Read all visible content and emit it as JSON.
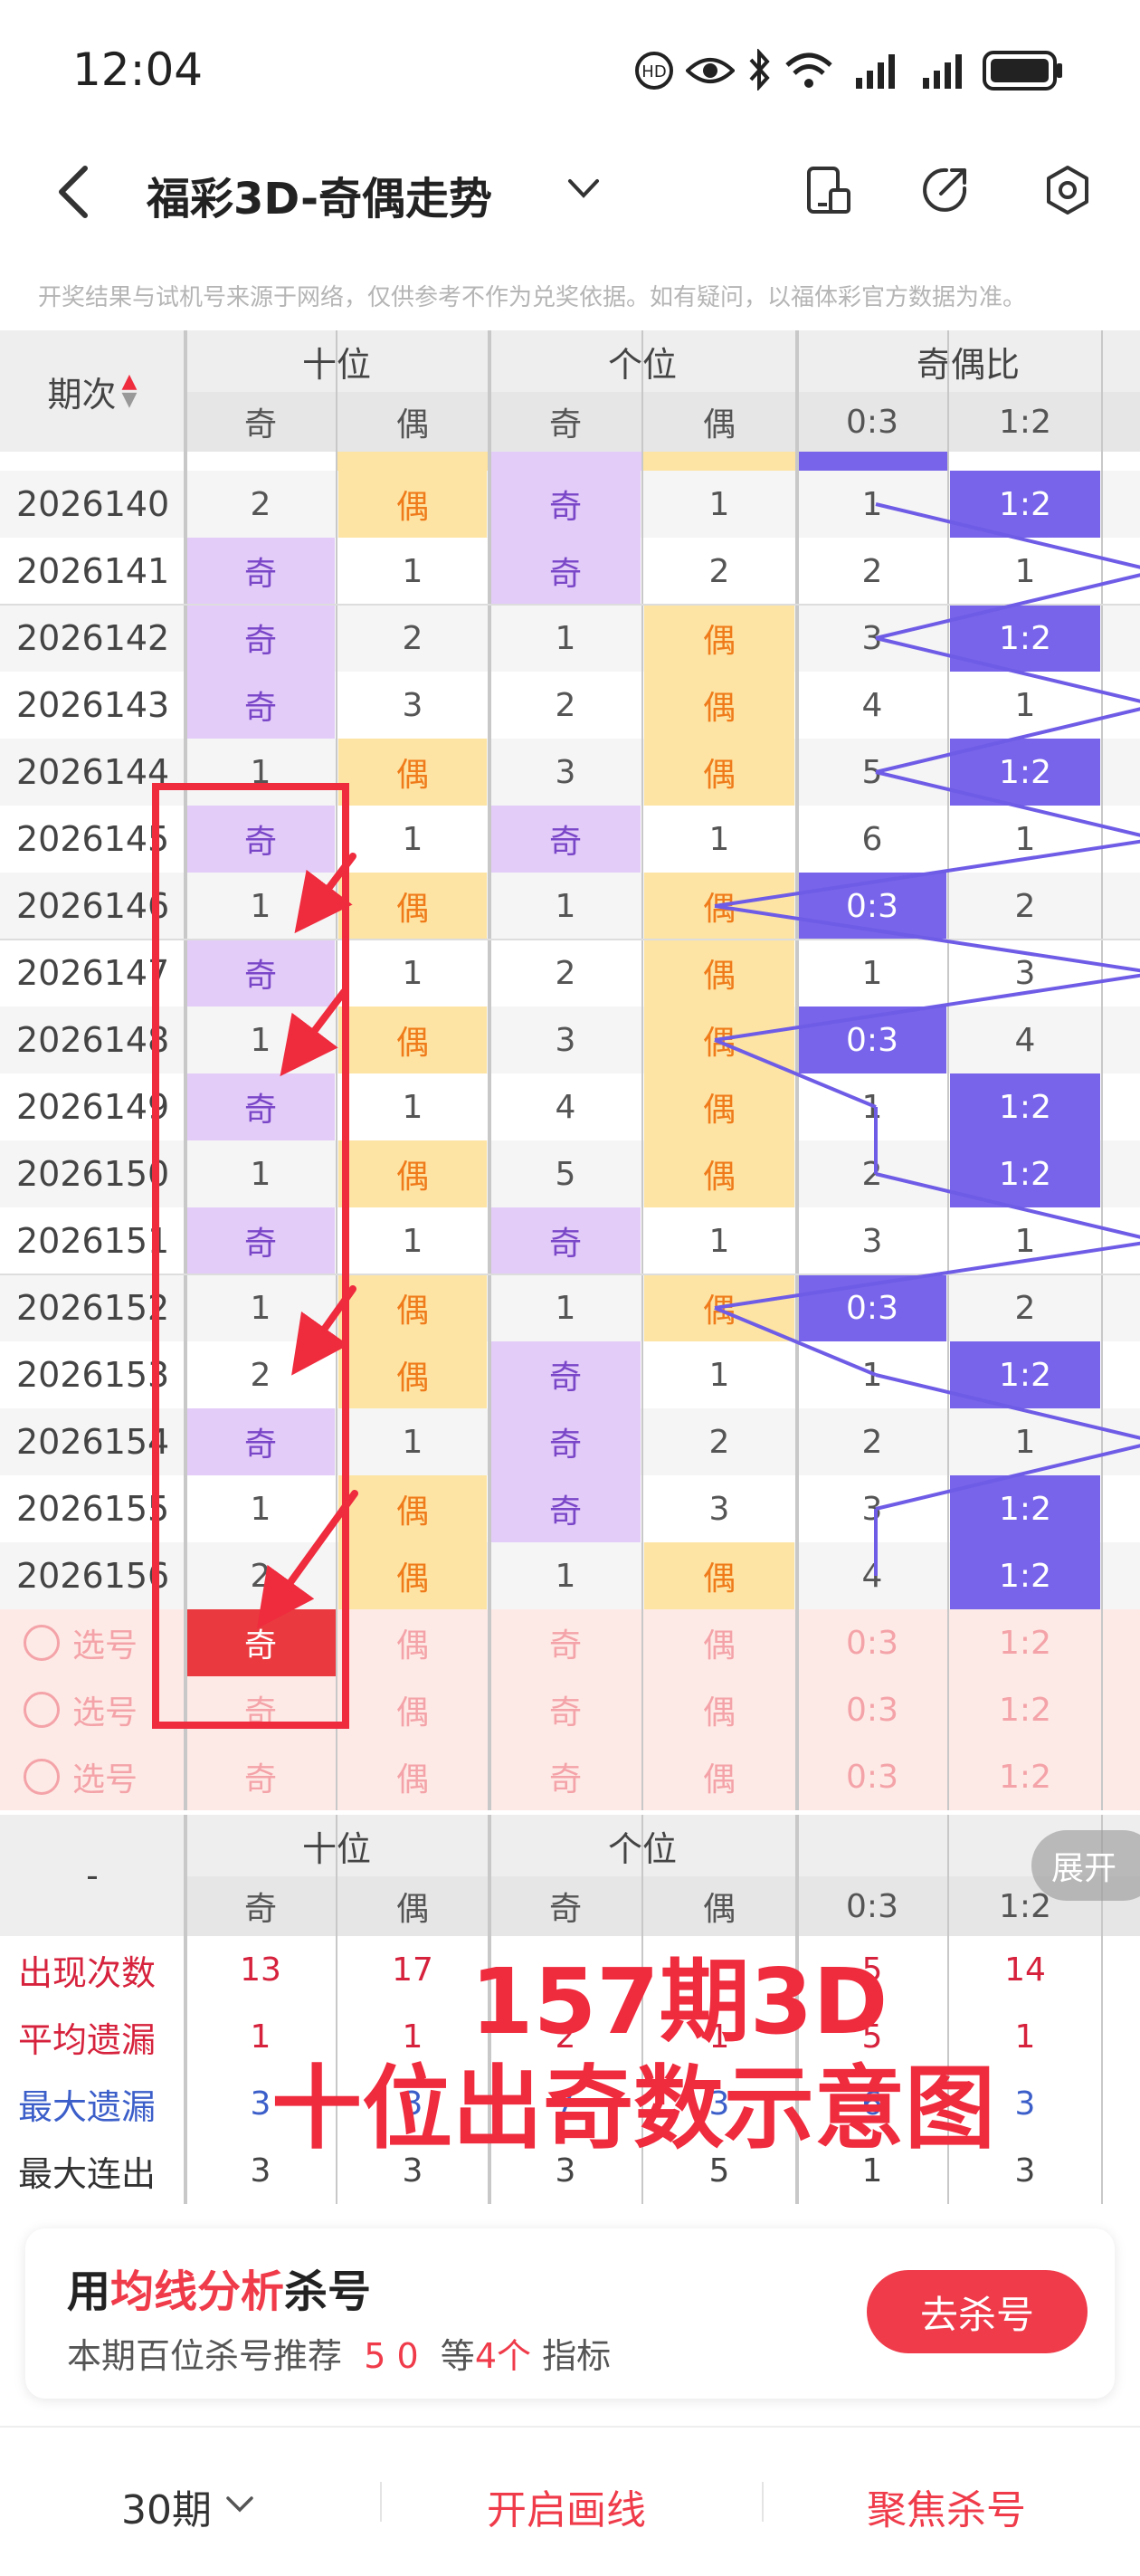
{
  "status_bar": {
    "time": "12:04",
    "icons": [
      "hd-call-icon",
      "eye-icon",
      "bluetooth-icon",
      "wifi-icon",
      "signal-icon",
      "signal-icon",
      "battery-icon"
    ]
  },
  "nav": {
    "title": "福彩3D-奇偶走势",
    "caret": "∨"
  },
  "disclaimer": "开奖结果与试机号来源于网络，仅供参考不作为兑奖依据。如有疑问，以福体彩官方数据为准。",
  "table": {
    "issue_header": "期次",
    "group_headers": [
      "十位",
      "个位",
      "奇偶比"
    ],
    "sub_headers": [
      "奇",
      "偶",
      "奇",
      "偶",
      "0:3",
      "1:2"
    ],
    "rows": [
      {
        "issue": "2026140",
        "cells": [
          "2",
          "偶",
          "奇",
          "1",
          "1",
          "1:2"
        ]
      },
      {
        "issue": "2026141",
        "cells": [
          "奇",
          "1",
          "奇",
          "2",
          "2",
          "1"
        ]
      },
      {
        "issue": "2026142",
        "cells": [
          "奇",
          "2",
          "1",
          "偶",
          "3",
          "1:2"
        ]
      },
      {
        "issue": "2026143",
        "cells": [
          "奇",
          "3",
          "2",
          "偶",
          "4",
          "1"
        ]
      },
      {
        "issue": "2026144",
        "cells": [
          "1",
          "偶",
          "3",
          "偶",
          "5",
          "1:2"
        ]
      },
      {
        "issue": "2026145",
        "cells": [
          "奇",
          "1",
          "奇",
          "1",
          "6",
          "1"
        ]
      },
      {
        "issue": "2026146",
        "cells": [
          "1",
          "偶",
          "1",
          "偶",
          "0:3",
          "2"
        ]
      },
      {
        "issue": "2026147",
        "cells": [
          "奇",
          "1",
          "2",
          "偶",
          "1",
          "3"
        ]
      },
      {
        "issue": "2026148",
        "cells": [
          "1",
          "偶",
          "3",
          "偶",
          "0:3",
          "4"
        ]
      },
      {
        "issue": "2026149",
        "cells": [
          "奇",
          "1",
          "4",
          "偶",
          "1",
          "1:2"
        ]
      },
      {
        "issue": "2026150",
        "cells": [
          "1",
          "偶",
          "5",
          "偶",
          "2",
          "1:2"
        ]
      },
      {
        "issue": "2026151",
        "cells": [
          "奇",
          "1",
          "奇",
          "1",
          "3",
          "1"
        ]
      },
      {
        "issue": "2026152",
        "cells": [
          "1",
          "偶",
          "1",
          "偶",
          "0:3",
          "2"
        ]
      },
      {
        "issue": "2026153",
        "cells": [
          "2",
          "偶",
          "奇",
          "1",
          "1",
          "1:2"
        ]
      },
      {
        "issue": "2026154",
        "cells": [
          "奇",
          "1",
          "奇",
          "2",
          "2",
          "1"
        ]
      },
      {
        "issue": "2026155",
        "cells": [
          "1",
          "偶",
          "奇",
          "3",
          "3",
          "1:2"
        ]
      },
      {
        "issue": "2026156",
        "cells": [
          "2",
          "偶",
          "1",
          "偶",
          "4",
          "1:2"
        ]
      }
    ],
    "select_label": "选号",
    "select_cells": [
      "奇",
      "偶",
      "奇",
      "偶",
      "0:3",
      "1:2"
    ]
  },
  "stats": {
    "dash": "-",
    "group_headers": [
      "十位",
      "个位"
    ],
    "sub_headers": [
      "奇",
      "偶",
      "奇",
      "偶",
      "0:3",
      "1:2"
    ],
    "rows": [
      {
        "label": "出现次数",
        "values": [
          "13",
          "17",
          "",
          "",
          "5",
          "14"
        ]
      },
      {
        "label": "平均遗漏",
        "values": [
          "1",
          "1",
          "2",
          "1",
          "5",
          "1"
        ]
      },
      {
        "label": "最大遗漏",
        "values": [
          "3",
          "3",
          "7",
          "3",
          "6",
          "3"
        ]
      },
      {
        "label": "最大连出",
        "values": [
          "3",
          "3",
          "3",
          "5",
          "1",
          "3"
        ]
      }
    ],
    "expand_label": "展开"
  },
  "annotation": {
    "line1": "157期3D",
    "line2": "十位出奇数示意图"
  },
  "promo": {
    "title_pre": "用",
    "title_highlight": "均线分析",
    "title_post": "杀号",
    "sub_pre": "本期百位杀号推荐",
    "sub_nums": "5 0",
    "sub_mid": "等",
    "sub_count": "4个",
    "sub_post": "指标",
    "button": "去杀号"
  },
  "bottom_bar": {
    "period": "30期",
    "period_caret": "∨",
    "draw_line": "开启画线",
    "focus_kill": "聚焦杀号"
  },
  "colors": {
    "odd_bg": "#e3ccf8",
    "even_bg": "#fde4a4",
    "ratio_bg": "#7764ea",
    "accent_red": "#ef3b4a"
  }
}
